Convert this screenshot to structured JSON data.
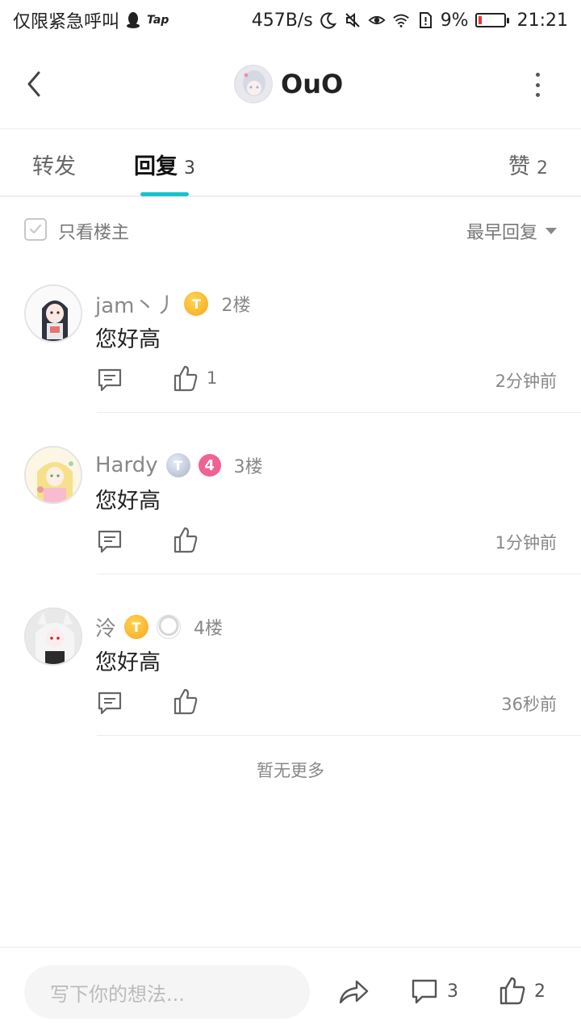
{
  "status_bar": {
    "carrier": "仅限紧急呼叫",
    "app_tag": "Tap",
    "net_speed": "457B/s",
    "battery_pct": "9%",
    "time": "21:21",
    "battery_level": 0.09
  },
  "header": {
    "title": "OuO"
  },
  "tabs": [
    {
      "label": "转发",
      "count": ""
    },
    {
      "label": "回复",
      "count": "3"
    },
    {
      "label": "赞",
      "count": "2"
    }
  ],
  "filter": {
    "only_op_label": "只看楼主",
    "sort_label": "最早回复"
  },
  "replies": [
    {
      "name": "jam丶丿",
      "badge": "T",
      "level": "",
      "floor": "2楼",
      "content": "您好高",
      "likes": "1",
      "time": "2分钟前"
    },
    {
      "name": "Hardy",
      "badge": "T",
      "level": "4",
      "floor": "3楼",
      "content": "您好高",
      "likes": "",
      "time": "1分钟前"
    },
    {
      "name": "泠",
      "badge": "T",
      "level": "",
      "floor": "4楼",
      "content": "您好高",
      "likes": "",
      "time": "36秒前"
    }
  ],
  "no_more": "暂无更多",
  "bottom_bar": {
    "input_placeholder": "写下你的想法...",
    "comment_count": "3",
    "like_count": "2"
  },
  "colors": {
    "accent": "#15c5ce",
    "badge_gold": "#f5a623",
    "badge_silver": "#aab4c8",
    "level_pink": "#f06292",
    "battery_low": "#e53935"
  },
  "icons": [
    "back-icon",
    "more-icon",
    "checkbox-icon",
    "caret-down-icon",
    "comment-icon",
    "thumbs-up-icon",
    "share-icon"
  ]
}
